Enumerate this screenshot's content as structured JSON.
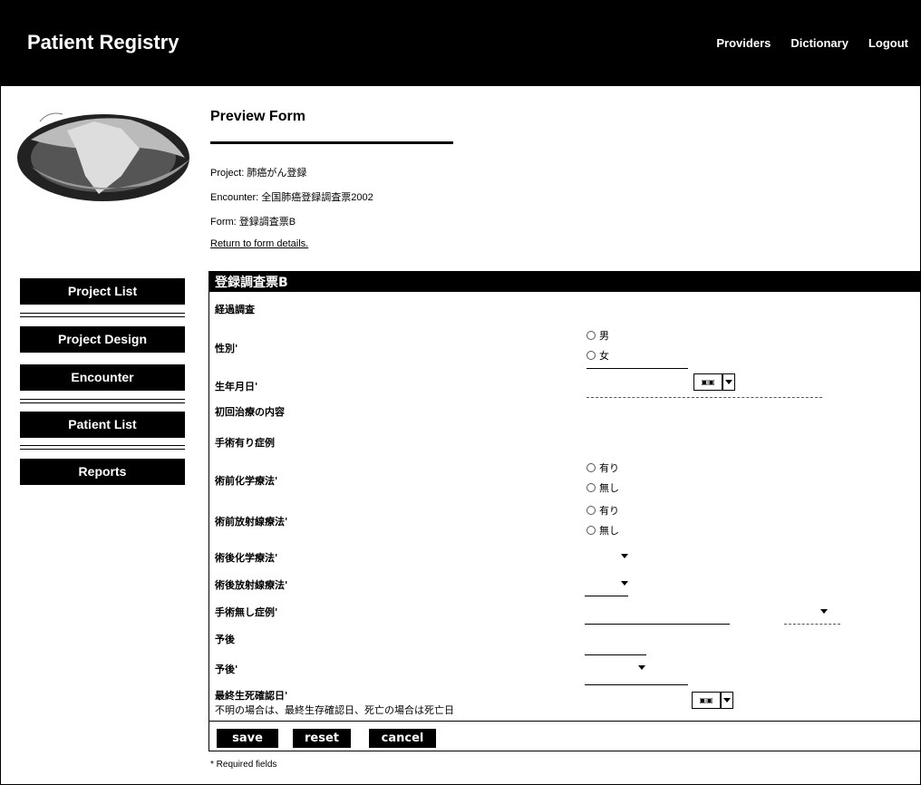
{
  "app": {
    "title": "Patient Registry"
  },
  "nav": {
    "providers": "Providers",
    "dictionary": "Dictionary",
    "logout": "Logout"
  },
  "sidebar": {
    "items": [
      {
        "label": "Project List"
      },
      {
        "label": "Project Design"
      },
      {
        "label": "Encounter"
      },
      {
        "label": "Patient List"
      },
      {
        "label": "Reports"
      }
    ]
  },
  "page": {
    "title": "Preview Form",
    "project": "Project: 肺癌がん登録",
    "encounter": "Encounter: 全国肺癌登録調査票2002",
    "form": "Form: 登録調査票B",
    "return_link": "Return to form details."
  },
  "form": {
    "header": "登録調査票B",
    "fields": {
      "followup": "経過調査",
      "sex": "性別'",
      "birthdate": "生年月日'",
      "initial_treatment": "初回治療の内容",
      "surgery_cases": "手術有り症例",
      "preop_chemo": "術前化学療法'",
      "preop_radiation": "術前放射線療法'",
      "postop_chemo": "術後化学療法'",
      "postop_radiation": "術後放射線療法'",
      "no_surgery_cases": "手術無し症例'",
      "prognosis": "予後",
      "prognosis2": "予後'",
      "last_confirmed": "最終生死確認日'",
      "last_confirmed_note": "不明の場合は、最終生存確認日、死亡の場合は死亡日"
    },
    "options": {
      "male": "男",
      "female": "女",
      "yes": "有り",
      "no": "無し"
    },
    "calendar_label": "▣▣",
    "buttons": {
      "save": "save",
      "reset": "reset",
      "cancel": "cancel"
    }
  },
  "footer": {
    "required_note": "* Required fields"
  }
}
